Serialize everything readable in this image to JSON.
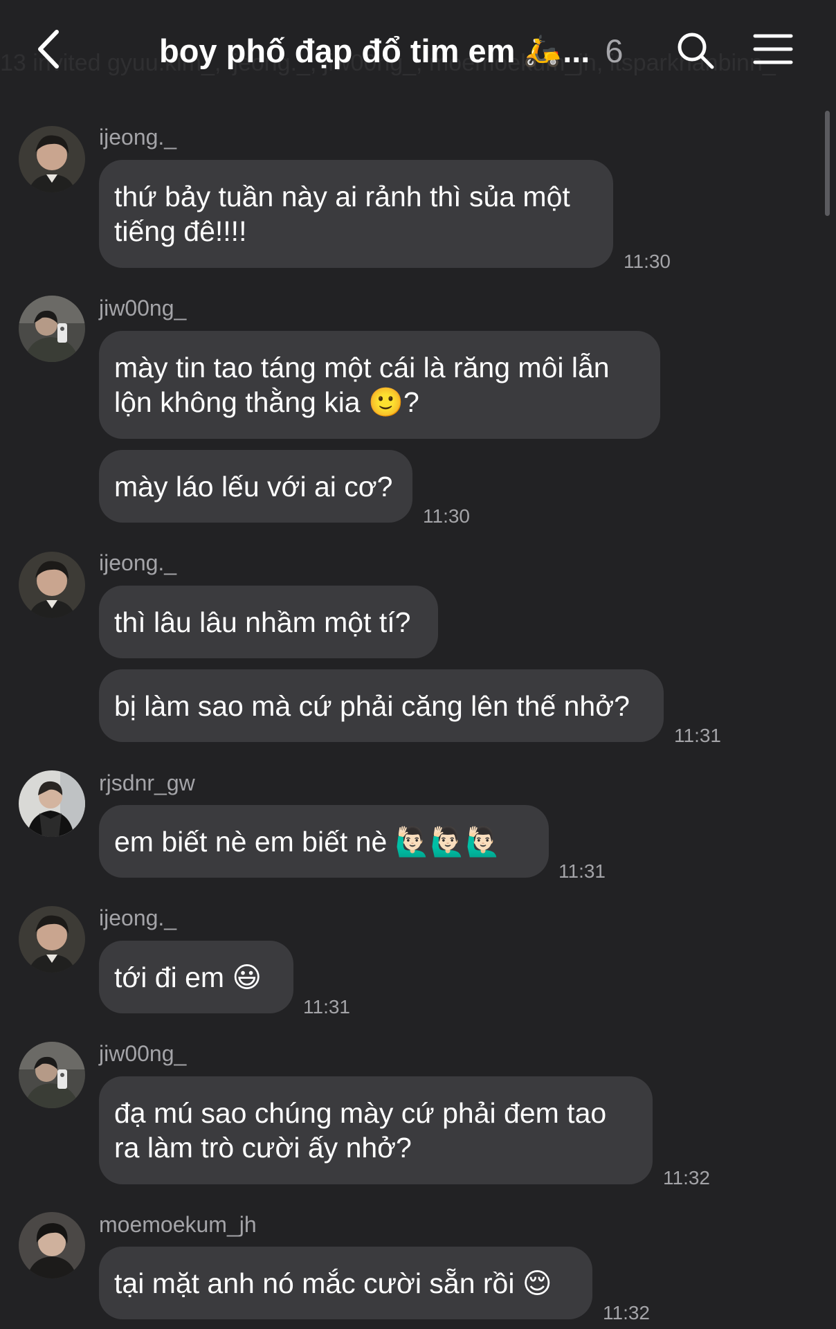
{
  "header": {
    "ghost_text": "13 invited gyuu.kim_, ijeong._, jiw00ng_, moemoekum_jh, itsparkhanbinn_",
    "title": "boy phố đạp đổ tim em",
    "title_emoji": "🛵",
    "title_ellipsis": "...",
    "member_count": "6",
    "icons": {
      "back": "chevron-left-icon",
      "search": "search-icon",
      "menu": "menu-icon"
    }
  },
  "colors": {
    "background": "#222224",
    "bubble": "#3b3b3e",
    "meta_text": "#a4a4a8",
    "text": "#ffffff"
  },
  "messages": [
    {
      "user": "ijeong._",
      "text_lines": [
        "thứ bảy tuần này ai rảnh thì sủa một",
        "tiếng đê!!!!"
      ],
      "time": "11:30"
    },
    {
      "user": "jiw00ng_",
      "text_lines": [
        "mày tin tao táng một cái là răng môi lẫn",
        "lộn không thằng kia 🙂?"
      ],
      "time": ""
    },
    {
      "user": "",
      "text_lines": [
        "mày láo lếu với ai cơ?"
      ],
      "time": "11:30"
    },
    {
      "user": "ijeong._",
      "text_lines": [
        "thì lâu lâu nhầm một tí?"
      ],
      "time": ""
    },
    {
      "user": "",
      "text_lines": [
        "bị làm sao mà cứ phải căng lên thế nhở?"
      ],
      "time": "11:31"
    },
    {
      "user": "rjsdnr_gw",
      "text_lines": [
        "em biết nè em biết nè 🙋🏻‍♂️🙋🏻‍♂️🙋🏻‍♂️"
      ],
      "time": "11:31"
    },
    {
      "user": "ijeong._",
      "text_lines": [
        "tới đi em 😃"
      ],
      "time": "11:31"
    },
    {
      "user": "jiw00ng_",
      "text_lines": [
        "đạ mú sao chúng mày cứ phải đem tao",
        "ra làm trò cười ấy nhở?"
      ],
      "time": "11:32"
    },
    {
      "user": "moemoekum_jh",
      "text_lines": [
        "tại mặt anh nó mắc cười sẵn rồi 😌"
      ],
      "time": "11:32"
    }
  ]
}
